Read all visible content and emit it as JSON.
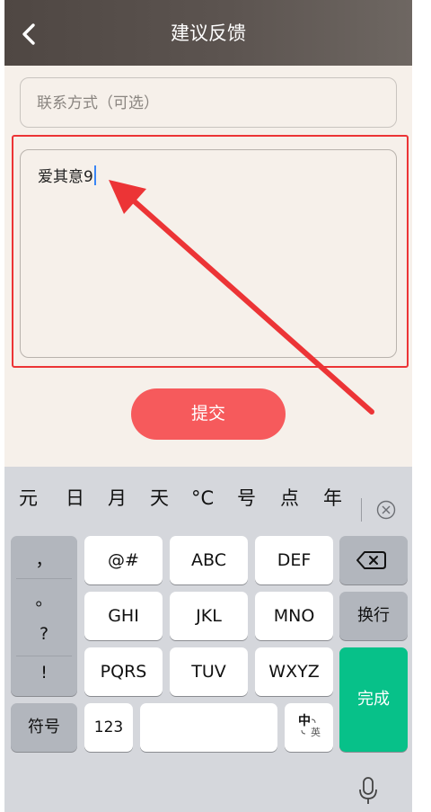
{
  "header": {
    "title": "建议反馈",
    "back_icon": "chevron-left-icon"
  },
  "form": {
    "contact_placeholder": "联系方式（可选）",
    "feedback_text": "爱其意9",
    "submit_label": "提交"
  },
  "keyboard": {
    "suggestions": [
      "元",
      "日",
      "月",
      "天",
      "°C",
      "号",
      "点",
      "年"
    ],
    "punctuation": [
      "，",
      "。",
      "?",
      "!"
    ],
    "row1": [
      "@#",
      "ABC",
      "DEF"
    ],
    "row2": [
      "GHI",
      "JKL",
      "MNO"
    ],
    "row3": [
      "PQRS",
      "TUV",
      "WXYZ"
    ],
    "newline_label": "换行",
    "done_label": "完成",
    "symbol_label": "符号",
    "numeric_label": "123",
    "lang_main": "中",
    "lang_sub": "英"
  },
  "colors": {
    "header_bg": "#5c5450",
    "page_bg": "#f6f0ea",
    "submit_bg": "#f65a5c",
    "done_bg": "#07c189",
    "annotation_red": "#ec3436",
    "caret": "#3a86f5"
  }
}
